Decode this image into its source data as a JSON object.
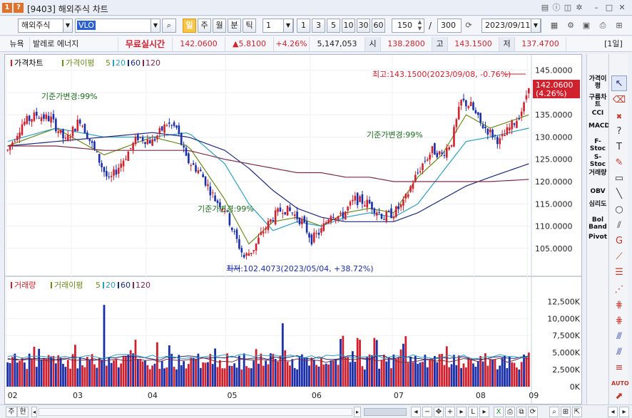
{
  "window": {
    "badge_num": "1",
    "badge_q": "?",
    "title": "[9403] 해외주식 차트",
    "icons": [
      "layout-icon",
      "info-icon",
      "camera-icon",
      "gear-icon",
      "minimize-icon",
      "maximize-icon",
      "close-icon"
    ]
  },
  "toolbar": {
    "market": "해외주식",
    "symbol": "VLO",
    "period_buttons": [
      "일",
      "주",
      "월",
      "분",
      "틱"
    ],
    "unit_value": "1",
    "unit_buttons": [
      "1",
      "3",
      "5",
      "10",
      "30",
      "60"
    ],
    "count": "150",
    "total": "300",
    "date": "2023/09/11"
  },
  "quote": {
    "exchange": "뉴욕",
    "name": "발레로 에너지",
    "realtime_label": "무료실시간",
    "price": "142.0600",
    "change": "▲5.8100",
    "change_pct": "+4.26%",
    "volume": "5,147,053",
    "open_label": "시",
    "open": "138.2800",
    "high_label": "고",
    "high": "143.1500",
    "low_label": "저",
    "low": "137.4700",
    "period_tag": "[1일]"
  },
  "price_legend": {
    "title": "가격차트",
    "ma_label": "가격이평",
    "periods": [
      "5",
      "20",
      "60",
      "120"
    ]
  },
  "volume_legend": {
    "title": "거래량",
    "ma_label": "거래이평",
    "periods": [
      "5",
      "20",
      "60",
      "120"
    ]
  },
  "annotations": {
    "high": "최고:143.1500(2023/09/08, -0.76%)",
    "low": "최저:102.4073(2023/05/04, +38.72%)",
    "base1": "기준가변경:99%",
    "base2": "기준가변경:99%",
    "base3": "기준가변경:99%"
  },
  "price_badge": {
    "price": "142.0600",
    "pct": "(4.26%)"
  },
  "price_axis": [
    "145.0000",
    "140.0000",
    "135.0000",
    "130.0000",
    "125.0000",
    "120.0000",
    "115.0000",
    "110.0000",
    "105.0000"
  ],
  "volume_axis": [
    "12,500K",
    "10,000K",
    "7,500K",
    "5,000K",
    "2,500K",
    "0K"
  ],
  "x_axis": [
    "02",
    "03",
    "04",
    "05",
    "06",
    "07",
    "08",
    "09"
  ],
  "indicators": [
    "가격이평",
    "구름차트",
    "CCI",
    "MACD",
    "F-Stoc",
    "S-Stoc",
    "거래량",
    "OBV",
    "심리도",
    "Bol Band",
    "Pivot"
  ],
  "bottom": {
    "label1": "주",
    "label2": "현"
  },
  "colors": {
    "up": "#d0222e",
    "down": "#1a2fa8",
    "ma5": "#6a8c1f",
    "ma20": "#2d9fc0",
    "ma60": "#1c2a7a",
    "ma120": "#7a2d4a",
    "active": "#f6c64a"
  },
  "chart_data": {
    "type": "candlestick",
    "price_range": [
      100.5,
      147.5
    ],
    "volume_range": [
      0,
      14000
    ],
    "x_months": [
      "02",
      "03",
      "04",
      "05",
      "06",
      "07",
      "08",
      "09"
    ],
    "price_path": [
      [
        0,
        127
      ],
      [
        6,
        133
      ],
      [
        12,
        135
      ],
      [
        18,
        134
      ],
      [
        24,
        129
      ],
      [
        30,
        134
      ],
      [
        36,
        127
      ],
      [
        42,
        120
      ],
      [
        48,
        125
      ],
      [
        54,
        130
      ],
      [
        60,
        129
      ],
      [
        66,
        133
      ],
      [
        70,
        132
      ],
      [
        74,
        125
      ],
      [
        80,
        122
      ],
      [
        86,
        116
      ],
      [
        90,
        114
      ],
      [
        94,
        108
      ],
      [
        98,
        103
      ],
      [
        102,
        105
      ],
      [
        106,
        109
      ],
      [
        110,
        112
      ],
      [
        114,
        114
      ],
      [
        118,
        113
      ],
      [
        122,
        111
      ],
      [
        126,
        107
      ],
      [
        130,
        109
      ],
      [
        134,
        113
      ],
      [
        138,
        112
      ],
      [
        144,
        116
      ],
      [
        150,
        115
      ],
      [
        156,
        112
      ],
      [
        160,
        113
      ],
      [
        164,
        115
      ],
      [
        168,
        120
      ],
      [
        172,
        124
      ],
      [
        176,
        127
      ],
      [
        180,
        126
      ],
      [
        184,
        129
      ],
      [
        188,
        138
      ],
      [
        192,
        137
      ],
      [
        196,
        133
      ],
      [
        200,
        131
      ],
      [
        204,
        129
      ],
      [
        208,
        132
      ],
      [
        211,
        134
      ],
      [
        214,
        137
      ],
      [
        216,
        142
      ]
    ],
    "ma5": [
      [
        0,
        128
      ],
      [
        20,
        132
      ],
      [
        40,
        126
      ],
      [
        60,
        130
      ],
      [
        75,
        128
      ],
      [
        90,
        116
      ],
      [
        100,
        106
      ],
      [
        110,
        111
      ],
      [
        120,
        112
      ],
      [
        130,
        110
      ],
      [
        140,
        113
      ],
      [
        150,
        114
      ],
      [
        160,
        113
      ],
      [
        170,
        121
      ],
      [
        180,
        126
      ],
      [
        190,
        135
      ],
      [
        200,
        132
      ],
      [
        216,
        135
      ]
    ],
    "ma20": [
      [
        0,
        129
      ],
      [
        20,
        132
      ],
      [
        40,
        130
      ],
      [
        60,
        130
      ],
      [
        75,
        131
      ],
      [
        90,
        124
      ],
      [
        100,
        115
      ],
      [
        110,
        109
      ],
      [
        120,
        111
      ],
      [
        130,
        110
      ],
      [
        140,
        112
      ],
      [
        150,
        113
      ],
      [
        160,
        112
      ],
      [
        170,
        115
      ],
      [
        180,
        122
      ],
      [
        190,
        129
      ],
      [
        200,
        130
      ],
      [
        216,
        132
      ]
    ],
    "ma60": [
      [
        0,
        128
      ],
      [
        20,
        129
      ],
      [
        40,
        130
      ],
      [
        60,
        131
      ],
      [
        75,
        130
      ],
      [
        90,
        127
      ],
      [
        100,
        123
      ],
      [
        110,
        118
      ],
      [
        120,
        114
      ],
      [
        130,
        112
      ],
      [
        140,
        111
      ],
      [
        150,
        111
      ],
      [
        160,
        111
      ],
      [
        170,
        113
      ],
      [
        180,
        116
      ],
      [
        190,
        119
      ],
      [
        200,
        121
      ],
      [
        216,
        124
      ]
    ],
    "ma120": [
      [
        0,
        128
      ],
      [
        20,
        128
      ],
      [
        40,
        127
      ],
      [
        60,
        127
      ],
      [
        75,
        127
      ],
      [
        90,
        125
      ],
      [
        100,
        124
      ],
      [
        110,
        123
      ],
      [
        120,
        122
      ],
      [
        130,
        122
      ],
      [
        140,
        121
      ],
      [
        150,
        121
      ],
      [
        160,
        120
      ],
      [
        170,
        120
      ],
      [
        180,
        120
      ],
      [
        190,
        120
      ],
      [
        200,
        120
      ],
      [
        216,
        120.5
      ]
    ],
    "volume_spikes": [
      [
        40,
        12000
      ],
      [
        62,
        6500
      ],
      [
        86,
        5600
      ],
      [
        114,
        9300
      ],
      [
        138,
        7000
      ],
      [
        164,
        6300
      ],
      [
        180,
        4800
      ],
      [
        196,
        4500
      ],
      [
        216,
        5000
      ]
    ],
    "volume_avg_line": 4200
  }
}
